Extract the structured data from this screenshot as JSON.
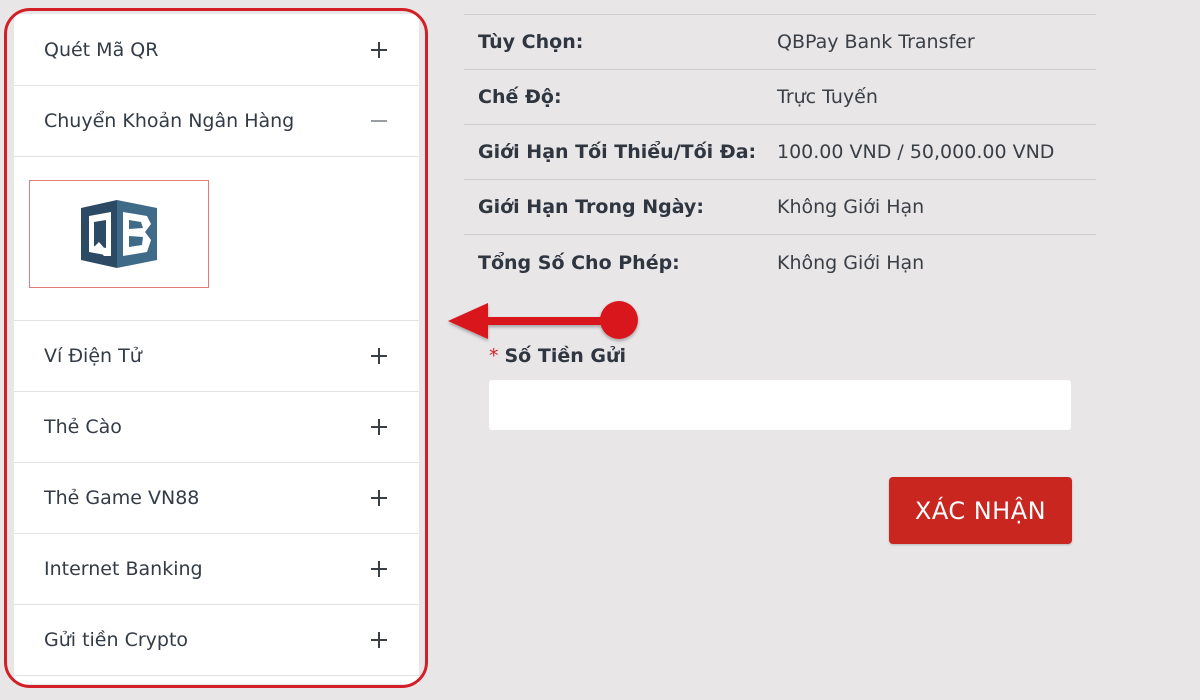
{
  "accordion": {
    "items": [
      {
        "label": "Quét Mã QR",
        "icon": "plus-icon"
      },
      {
        "label": "Chuyển Khoản Ngân Hàng",
        "icon": "minus-icon",
        "expanded": true
      },
      {
        "label": "Ví Điện Tử",
        "icon": "plus-icon"
      },
      {
        "label": "Thẻ Cào",
        "icon": "plus-icon"
      },
      {
        "label": "Thẻ Game VN88",
        "icon": "plus-icon"
      },
      {
        "label": "Internet Banking",
        "icon": "plus-icon"
      },
      {
        "label": "Gửi tiền Crypto",
        "icon": "plus-icon"
      }
    ],
    "selected_bank_logo": "qbpay-logo"
  },
  "info": {
    "rows": [
      {
        "key": "Tùy Chọn:",
        "value": "QBPay Bank Transfer"
      },
      {
        "key": "Chế Độ:",
        "value": "Trực Tuyến"
      },
      {
        "key": "Giới Hạn Tối Thiểu/Tối Đa:",
        "value": "100.00 VND / 50,000.00 VND"
      },
      {
        "key": "Giới Hạn Trong Ngày:",
        "value": "Không Giới Hạn"
      },
      {
        "key": "Tổng Số Cho Phép:",
        "value": "Không Giới Hạn"
      }
    ]
  },
  "deposit": {
    "required_mark": "*",
    "label": "Số Tiền Gửi",
    "value": "",
    "placeholder": ""
  },
  "actions": {
    "confirm_label": "XÁC NHẬN"
  },
  "colors": {
    "accent": "#c8261f",
    "highlight": "#d32028",
    "background": "#e8e6e7"
  }
}
